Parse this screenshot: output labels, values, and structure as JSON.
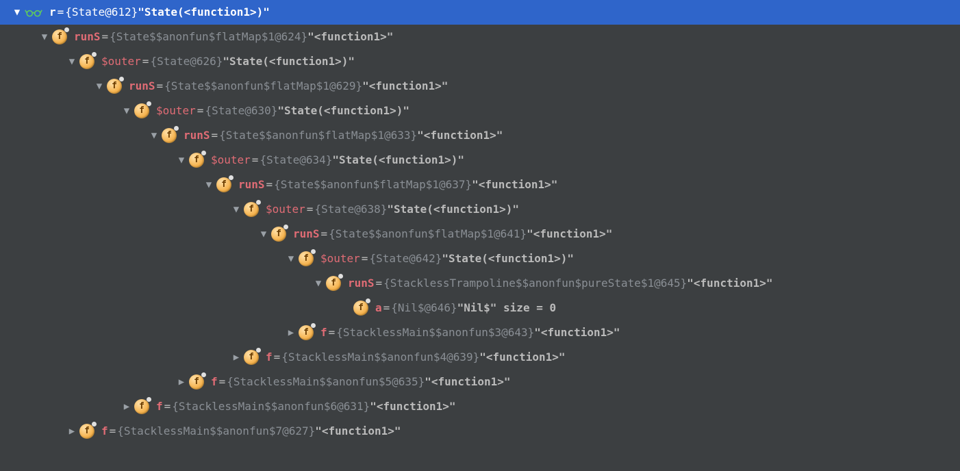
{
  "rows": [
    {
      "indent": 0,
      "selected": true,
      "arrow": "down",
      "icon": "glasses",
      "nameClass": "name-root",
      "name": "r",
      "type": "{State@612}",
      "value": "\"State(<function1>)\""
    },
    {
      "indent": 1,
      "selected": false,
      "arrow": "down",
      "icon": "field",
      "nameClass": "name-a",
      "name": "runS",
      "type": "{State$$anonfun$flatMap$1@624}",
      "value": "\"<function1>\""
    },
    {
      "indent": 2,
      "selected": false,
      "arrow": "down",
      "icon": "field",
      "nameClass": "name-b",
      "name": "$outer",
      "type": "{State@626}",
      "value": "\"State(<function1>)\""
    },
    {
      "indent": 3,
      "selected": false,
      "arrow": "down",
      "icon": "field",
      "nameClass": "name-a",
      "name": "runS",
      "type": "{State$$anonfun$flatMap$1@629}",
      "value": "\"<function1>\""
    },
    {
      "indent": 4,
      "selected": false,
      "arrow": "down",
      "icon": "field",
      "nameClass": "name-b",
      "name": "$outer",
      "type": "{State@630}",
      "value": "\"State(<function1>)\""
    },
    {
      "indent": 5,
      "selected": false,
      "arrow": "down",
      "icon": "field",
      "nameClass": "name-a",
      "name": "runS",
      "type": "{State$$anonfun$flatMap$1@633}",
      "value": "\"<function1>\""
    },
    {
      "indent": 6,
      "selected": false,
      "arrow": "down",
      "icon": "field",
      "nameClass": "name-b",
      "name": "$outer",
      "type": "{State@634}",
      "value": "\"State(<function1>)\""
    },
    {
      "indent": 7,
      "selected": false,
      "arrow": "down",
      "icon": "field",
      "nameClass": "name-a",
      "name": "runS",
      "type": "{State$$anonfun$flatMap$1@637}",
      "value": "\"<function1>\""
    },
    {
      "indent": 8,
      "selected": false,
      "arrow": "down",
      "icon": "field",
      "nameClass": "name-b",
      "name": "$outer",
      "type": "{State@638}",
      "value": "\"State(<function1>)\""
    },
    {
      "indent": 9,
      "selected": false,
      "arrow": "down",
      "icon": "field",
      "nameClass": "name-a",
      "name": "runS",
      "type": "{State$$anonfun$flatMap$1@641}",
      "value": "\"<function1>\""
    },
    {
      "indent": 10,
      "selected": false,
      "arrow": "down",
      "icon": "field",
      "nameClass": "name-b",
      "name": "$outer",
      "type": "{State@642}",
      "value": "\"State(<function1>)\""
    },
    {
      "indent": 11,
      "selected": false,
      "arrow": "down",
      "icon": "field",
      "nameClass": "name-a",
      "name": "runS",
      "type": "{StacklessTrampoline$$anonfun$pureState$1@645}",
      "value": "\"<function1>\""
    },
    {
      "indent": 12,
      "selected": false,
      "arrow": "none",
      "icon": "field",
      "nameClass": "name-a",
      "name": "a",
      "type": "{Nil$@646}",
      "value": "\"Nil$\" size = 0"
    },
    {
      "indent": 10,
      "selected": false,
      "arrow": "right",
      "icon": "field",
      "nameClass": "name-a",
      "name": "f",
      "type": "{StacklessMain$$anonfun$3@643}",
      "value": "\"<function1>\""
    },
    {
      "indent": 8,
      "selected": false,
      "arrow": "right",
      "icon": "field",
      "nameClass": "name-a",
      "name": "f",
      "type": "{StacklessMain$$anonfun$4@639}",
      "value": "\"<function1>\""
    },
    {
      "indent": 6,
      "selected": false,
      "arrow": "right",
      "icon": "field",
      "nameClass": "name-a",
      "name": "f",
      "type": "{StacklessMain$$anonfun$5@635}",
      "value": "\"<function1>\""
    },
    {
      "indent": 4,
      "selected": false,
      "arrow": "right",
      "icon": "field",
      "nameClass": "name-a",
      "name": "f",
      "type": "{StacklessMain$$anonfun$6@631}",
      "value": "\"<function1>\""
    },
    {
      "indent": 2,
      "selected": false,
      "arrow": "right",
      "icon": "field",
      "nameClass": "name-a",
      "name": "f",
      "type": "{StacklessMain$$anonfun$7@627}",
      "value": "\"<function1>\""
    }
  ]
}
